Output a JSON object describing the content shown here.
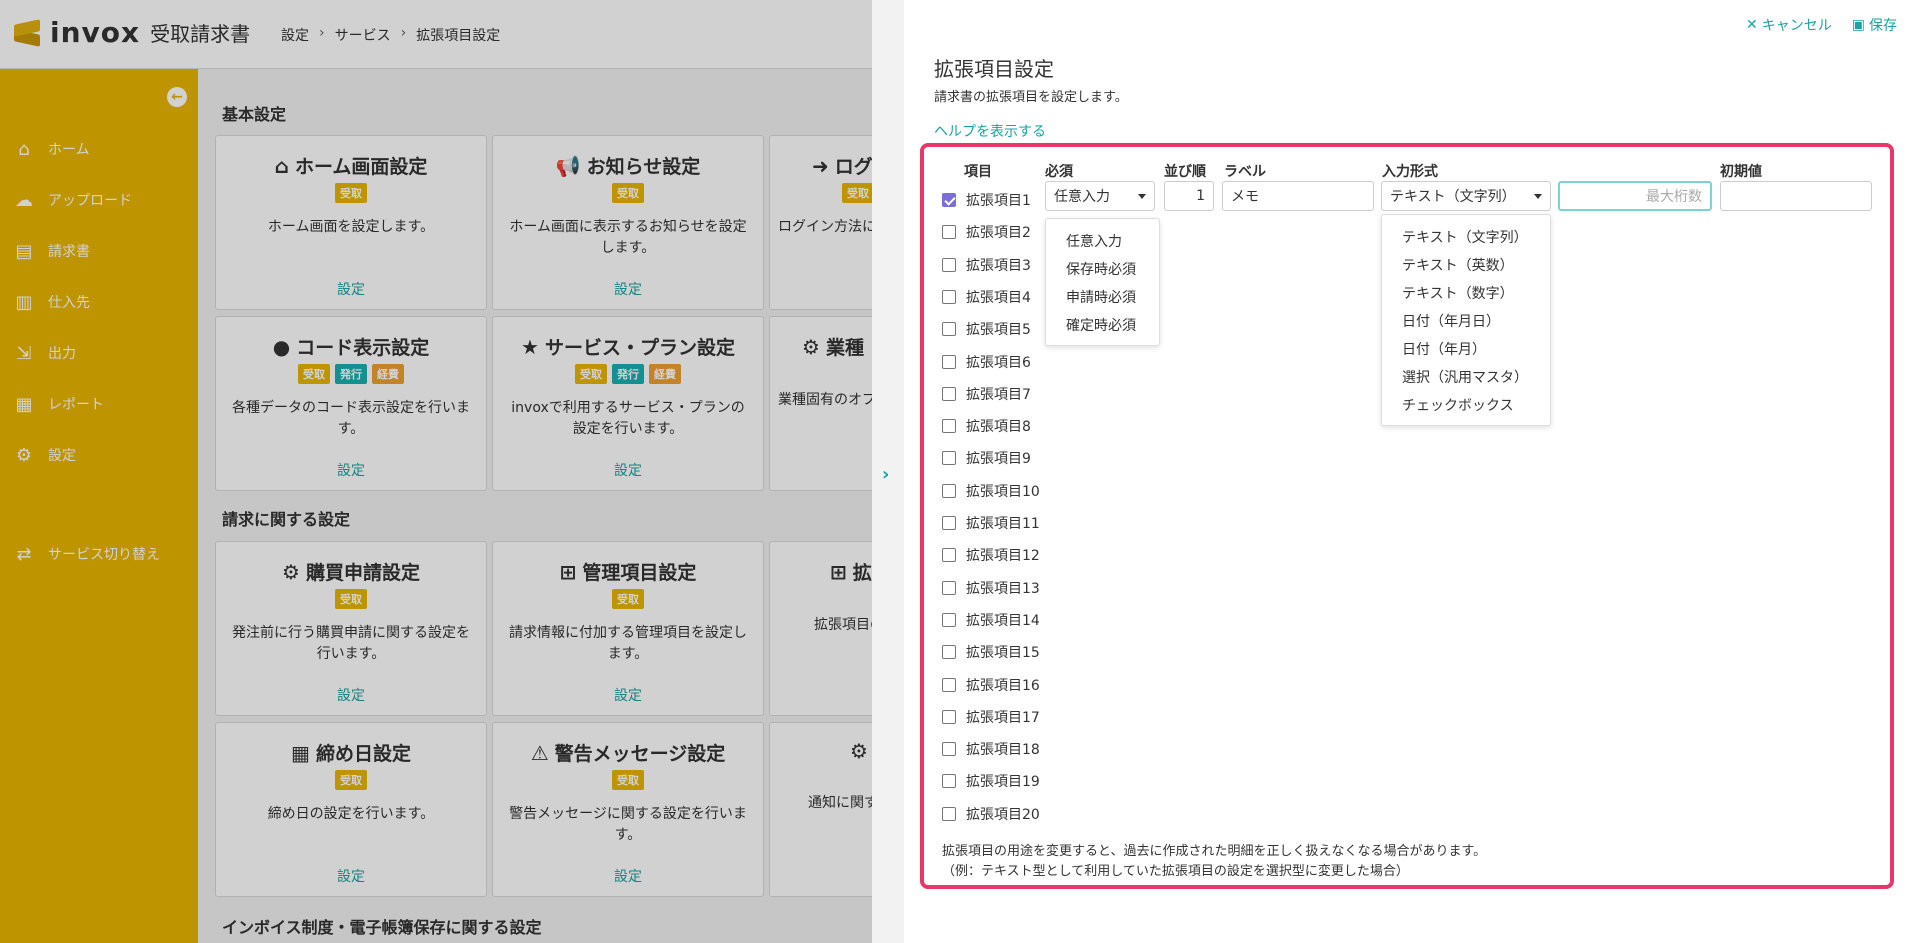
{
  "app": {
    "brand": "invox",
    "product": "受取請求書"
  },
  "breadcrumb": [
    "設定",
    "サービス",
    "拡張項目設定"
  ],
  "sidebar": {
    "items": [
      {
        "label": "ホーム",
        "icon": "home-icon"
      },
      {
        "label": "アップロード",
        "icon": "cloud-upload-icon"
      },
      {
        "label": "請求書",
        "icon": "document-icon"
      },
      {
        "label": "仕入先",
        "icon": "building-icon"
      },
      {
        "label": "出力",
        "icon": "export-icon"
      },
      {
        "label": "レポート",
        "icon": "chart-icon"
      },
      {
        "label": "設定",
        "icon": "gear-icon"
      },
      {
        "label": "サービス切り替え",
        "icon": "switch-icon"
      }
    ]
  },
  "main": {
    "sections": [
      "基本設定",
      "請求に関する設定",
      "インボイス制度・電子帳簿保存に関する設定"
    ],
    "cards": [
      {
        "title": "ホーム画面設定",
        "icon": "home-icon",
        "badges": [
          "受取"
        ],
        "desc": "ホーム画面を設定します。",
        "link": "設定"
      },
      {
        "title": "お知らせ設定",
        "icon": "megaphone-icon",
        "badges": [
          "受取"
        ],
        "desc": "ホーム画面に表示するお知らせを設定します。",
        "link": "設定"
      },
      {
        "title": "ログ",
        "icon": "login-icon",
        "badges": [
          "受取"
        ],
        "desc": "ログイン方法に",
        "link": ""
      },
      {
        "title": "コード表示設定",
        "icon": "abc-icon",
        "badges": [
          "受取",
          "発行",
          "経費"
        ],
        "desc": "各種データのコード表示設定を行います。",
        "link": "設定"
      },
      {
        "title": "サービス・プラン設定",
        "icon": "star-icon",
        "badges": [
          "受取",
          "発行",
          "経費"
        ],
        "desc": "invoxで利用するサービス・プランの設定を行います。",
        "link": "設定"
      },
      {
        "title": "業種",
        "icon": "gears-icon",
        "badges": [],
        "desc": "業種固有のオプ",
        "link": ""
      },
      {
        "title": "購買申請設定",
        "icon": "gears-icon",
        "badges": [
          "受取"
        ],
        "desc": "発注前に行う購買申請に関する設定を行います。",
        "link": "設定"
      },
      {
        "title": "管理項目設定",
        "icon": "sitemap-icon",
        "badges": [
          "受取"
        ],
        "desc": "請求情報に付加する管理項目を設定します。",
        "link": "設定"
      },
      {
        "title": "拡",
        "icon": "sitemap-icon",
        "badges": [],
        "desc": "拡張項目の",
        "link": ""
      },
      {
        "title": "締め日設定",
        "icon": "calendar-icon",
        "badges": [
          "受取"
        ],
        "desc": "締め日の設定を行います。",
        "link": "設定"
      },
      {
        "title": "警告メッセージ設定",
        "icon": "warning-icon",
        "badges": [
          "受取"
        ],
        "desc": "警告メッセージに関する設定を行います。",
        "link": "設定"
      },
      {
        "title": "",
        "icon": "gears-icon",
        "badges": [],
        "desc": "通知に関す",
        "link": ""
      }
    ]
  },
  "drawer": {
    "cancel": "キャンセル",
    "save": "保存",
    "title": "拡張項目設定",
    "desc": "請求書の拡張項目を設定します。",
    "help": "ヘルプを表示する",
    "headers": {
      "item": "項目",
      "required": "必須",
      "order": "並び順",
      "label": "ラベル",
      "input_type": "入力形式",
      "initial": "初期値"
    },
    "items": [
      "拡張項目1",
      "拡張項目2",
      "拡張項目3",
      "拡張項目4",
      "拡張項目5",
      "拡張項目6",
      "拡張項目7",
      "拡張項目8",
      "拡張項目9",
      "拡張項目10",
      "拡張項目11",
      "拡張項目12",
      "拡張項目13",
      "拡張項目14",
      "拡張項目15",
      "拡張項目16",
      "拡張項目17",
      "拡張項目18",
      "拡張項目19",
      "拡張項目20"
    ],
    "row1": {
      "required": "任意入力",
      "order": "1",
      "label": "メモ",
      "input_type": "テキスト（文字列）",
      "max_digits_placeholder": "最大桁数",
      "initial": ""
    },
    "required_options": [
      "任意入力",
      "保存時必須",
      "申請時必須",
      "確定時必須"
    ],
    "input_type_options": [
      "テキスト（文字列）",
      "テキスト（英数）",
      "テキスト（数字）",
      "日付（年月日）",
      "日付（年月）",
      "選択（汎用マスタ）",
      "チェックボックス"
    ],
    "note": [
      "拡張項目の用途を変更すると、過去に作成された明細を正しく扱えなくなる場合があります。",
      "（例：テキスト型として利用していた拡張項目の設定を選択型に変更した場合）"
    ]
  },
  "colors": {
    "brand": "#e8b500",
    "accent": "#1aa3a3",
    "highlight": "#e8386a"
  }
}
